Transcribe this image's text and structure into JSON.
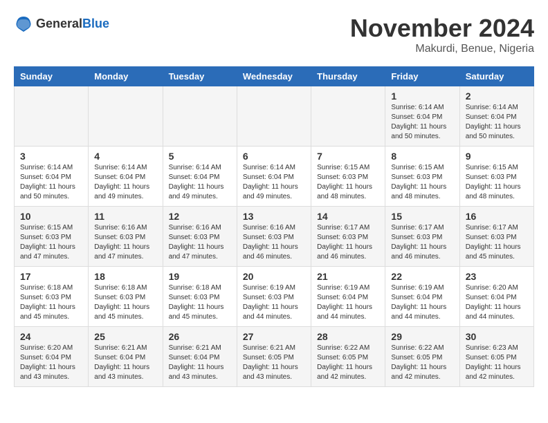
{
  "logo": {
    "general": "General",
    "blue": "Blue"
  },
  "title": "November 2024",
  "subtitle": "Makurdi, Benue, Nigeria",
  "weekdays": [
    "Sunday",
    "Monday",
    "Tuesday",
    "Wednesday",
    "Thursday",
    "Friday",
    "Saturday"
  ],
  "weeks": [
    [
      {
        "day": "",
        "info": ""
      },
      {
        "day": "",
        "info": ""
      },
      {
        "day": "",
        "info": ""
      },
      {
        "day": "",
        "info": ""
      },
      {
        "day": "",
        "info": ""
      },
      {
        "day": "1",
        "info": "Sunrise: 6:14 AM\nSunset: 6:04 PM\nDaylight: 11 hours\nand 50 minutes."
      },
      {
        "day": "2",
        "info": "Sunrise: 6:14 AM\nSunset: 6:04 PM\nDaylight: 11 hours\nand 50 minutes."
      }
    ],
    [
      {
        "day": "3",
        "info": "Sunrise: 6:14 AM\nSunset: 6:04 PM\nDaylight: 11 hours\nand 50 minutes."
      },
      {
        "day": "4",
        "info": "Sunrise: 6:14 AM\nSunset: 6:04 PM\nDaylight: 11 hours\nand 49 minutes."
      },
      {
        "day": "5",
        "info": "Sunrise: 6:14 AM\nSunset: 6:04 PM\nDaylight: 11 hours\nand 49 minutes."
      },
      {
        "day": "6",
        "info": "Sunrise: 6:14 AM\nSunset: 6:04 PM\nDaylight: 11 hours\nand 49 minutes."
      },
      {
        "day": "7",
        "info": "Sunrise: 6:15 AM\nSunset: 6:03 PM\nDaylight: 11 hours\nand 48 minutes."
      },
      {
        "day": "8",
        "info": "Sunrise: 6:15 AM\nSunset: 6:03 PM\nDaylight: 11 hours\nand 48 minutes."
      },
      {
        "day": "9",
        "info": "Sunrise: 6:15 AM\nSunset: 6:03 PM\nDaylight: 11 hours\nand 48 minutes."
      }
    ],
    [
      {
        "day": "10",
        "info": "Sunrise: 6:15 AM\nSunset: 6:03 PM\nDaylight: 11 hours\nand 47 minutes."
      },
      {
        "day": "11",
        "info": "Sunrise: 6:16 AM\nSunset: 6:03 PM\nDaylight: 11 hours\nand 47 minutes."
      },
      {
        "day": "12",
        "info": "Sunrise: 6:16 AM\nSunset: 6:03 PM\nDaylight: 11 hours\nand 47 minutes."
      },
      {
        "day": "13",
        "info": "Sunrise: 6:16 AM\nSunset: 6:03 PM\nDaylight: 11 hours\nand 46 minutes."
      },
      {
        "day": "14",
        "info": "Sunrise: 6:17 AM\nSunset: 6:03 PM\nDaylight: 11 hours\nand 46 minutes."
      },
      {
        "day": "15",
        "info": "Sunrise: 6:17 AM\nSunset: 6:03 PM\nDaylight: 11 hours\nand 46 minutes."
      },
      {
        "day": "16",
        "info": "Sunrise: 6:17 AM\nSunset: 6:03 PM\nDaylight: 11 hours\nand 45 minutes."
      }
    ],
    [
      {
        "day": "17",
        "info": "Sunrise: 6:18 AM\nSunset: 6:03 PM\nDaylight: 11 hours\nand 45 minutes."
      },
      {
        "day": "18",
        "info": "Sunrise: 6:18 AM\nSunset: 6:03 PM\nDaylight: 11 hours\nand 45 minutes."
      },
      {
        "day": "19",
        "info": "Sunrise: 6:18 AM\nSunset: 6:03 PM\nDaylight: 11 hours\nand 45 minutes."
      },
      {
        "day": "20",
        "info": "Sunrise: 6:19 AM\nSunset: 6:03 PM\nDaylight: 11 hours\nand 44 minutes."
      },
      {
        "day": "21",
        "info": "Sunrise: 6:19 AM\nSunset: 6:04 PM\nDaylight: 11 hours\nand 44 minutes."
      },
      {
        "day": "22",
        "info": "Sunrise: 6:19 AM\nSunset: 6:04 PM\nDaylight: 11 hours\nand 44 minutes."
      },
      {
        "day": "23",
        "info": "Sunrise: 6:20 AM\nSunset: 6:04 PM\nDaylight: 11 hours\nand 44 minutes."
      }
    ],
    [
      {
        "day": "24",
        "info": "Sunrise: 6:20 AM\nSunset: 6:04 PM\nDaylight: 11 hours\nand 43 minutes."
      },
      {
        "day": "25",
        "info": "Sunrise: 6:21 AM\nSunset: 6:04 PM\nDaylight: 11 hours\nand 43 minutes."
      },
      {
        "day": "26",
        "info": "Sunrise: 6:21 AM\nSunset: 6:04 PM\nDaylight: 11 hours\nand 43 minutes."
      },
      {
        "day": "27",
        "info": "Sunrise: 6:21 AM\nSunset: 6:05 PM\nDaylight: 11 hours\nand 43 minutes."
      },
      {
        "day": "28",
        "info": "Sunrise: 6:22 AM\nSunset: 6:05 PM\nDaylight: 11 hours\nand 42 minutes."
      },
      {
        "day": "29",
        "info": "Sunrise: 6:22 AM\nSunset: 6:05 PM\nDaylight: 11 hours\nand 42 minutes."
      },
      {
        "day": "30",
        "info": "Sunrise: 6:23 AM\nSunset: 6:05 PM\nDaylight: 11 hours\nand 42 minutes."
      }
    ]
  ]
}
